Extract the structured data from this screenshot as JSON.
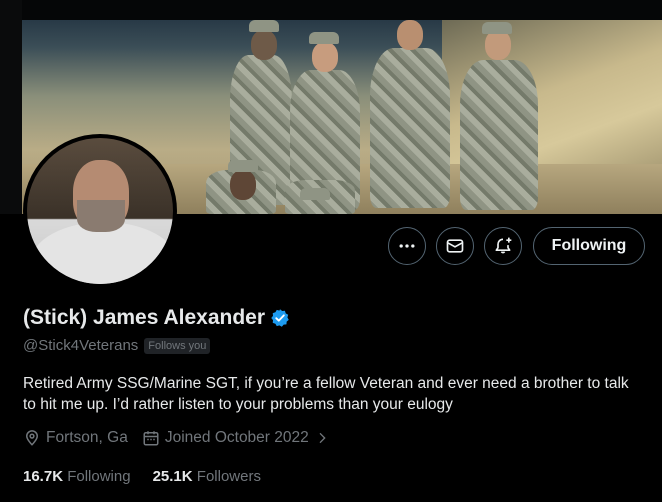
{
  "profile": {
    "name": "(Stick) James Alexander",
    "handle": "@Stick4Veterans",
    "follows_you": "Follows you",
    "bio": "Retired Army SSG/Marine SGT, if you’re a fellow Veteran and ever need a brother to talk to hit me up. I’d rather listen to your problems than your eulogy",
    "location": "Fortson, Ga",
    "joined": "Joined October 2022",
    "following_count": "16.7K",
    "following_label": "Following",
    "followers_count": "25.1K",
    "followers_label": "Followers"
  },
  "actions": {
    "more_icon": "more-icon",
    "message_icon": "mail-icon",
    "notify_icon": "bell-plus-icon",
    "follow_button": "Following"
  },
  "colors": {
    "background": "#000000",
    "primary_text": "#e7e9ea",
    "secondary_text": "#71767b",
    "verified": "#1d9bf0",
    "border": "#536471"
  }
}
